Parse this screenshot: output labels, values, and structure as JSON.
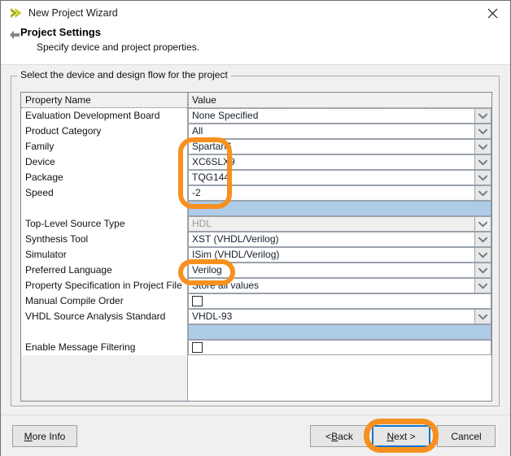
{
  "window": {
    "title": "New Project Wizard",
    "app_icon": "chevron-right-icon",
    "close_icon": "close-icon"
  },
  "header": {
    "back_icon": "back-arrow-icon",
    "title": "Project Settings",
    "subtitle": "Specify device and project properties."
  },
  "groupbox": {
    "title": "Select the device and design flow for the project"
  },
  "grid": {
    "columns": [
      "Property Name",
      "Value"
    ],
    "rows": [
      {
        "name": "Evaluation Development Board",
        "value": "None Specified",
        "type": "combo",
        "disabled": false
      },
      {
        "name": "Product Category",
        "value": "All",
        "type": "combo",
        "disabled": false
      },
      {
        "name": "Family",
        "value": "Spartan6",
        "type": "combo",
        "disabled": false
      },
      {
        "name": "Device",
        "value": "XC6SLX9",
        "type": "combo",
        "disabled": false
      },
      {
        "name": "Package",
        "value": "TQG144",
        "type": "combo",
        "disabled": false
      },
      {
        "name": "Speed",
        "value": "-2",
        "type": "combo",
        "disabled": false
      },
      {
        "name": "",
        "value": "",
        "type": "selected",
        "disabled": false
      },
      {
        "name": "Top-Level Source Type",
        "value": "HDL",
        "type": "combo",
        "disabled": true
      },
      {
        "name": "Synthesis Tool",
        "value": "XST (VHDL/Verilog)",
        "type": "combo",
        "disabled": false
      },
      {
        "name": "Simulator",
        "value": "ISim (VHDL/Verilog)",
        "type": "combo",
        "disabled": false
      },
      {
        "name": "Preferred Language",
        "value": "Verilog",
        "type": "combo",
        "disabled": false
      },
      {
        "name": "Property Specification in Project File",
        "value": "Store all values",
        "type": "combo",
        "disabled": false
      },
      {
        "name": "Manual Compile Order",
        "value": "",
        "type": "checkbox",
        "disabled": false
      },
      {
        "name": "VHDL Source Analysis Standard",
        "value": "VHDL-93",
        "type": "combo",
        "disabled": false
      },
      {
        "name": "",
        "value": "",
        "type": "selected",
        "disabled": false
      },
      {
        "name": "Enable Message Filtering",
        "value": "",
        "type": "checkbox",
        "disabled": false
      }
    ]
  },
  "footer": {
    "more_info": {
      "pre": "",
      "mnemonic": "M",
      "post": "ore Info"
    },
    "back": {
      "pre": "< ",
      "mnemonic": "B",
      "post": "ack"
    },
    "next": {
      "pre": "",
      "mnemonic": "N",
      "post": "ext >"
    },
    "cancel": {
      "pre": "",
      "mnemonic": "",
      "post": "Cancel"
    }
  },
  "annotations": {
    "color": "#f7901e",
    "items": [
      {
        "target": "device-fields-highlight"
      },
      {
        "target": "preferred-language-highlight"
      },
      {
        "target": "next-button-highlight"
      }
    ]
  },
  "colors": {
    "accent_orange": "#f7901e",
    "focus_blue": "#0f76d0",
    "selection_blue": "#aecbe8",
    "icon_olive": "#a2a817"
  }
}
